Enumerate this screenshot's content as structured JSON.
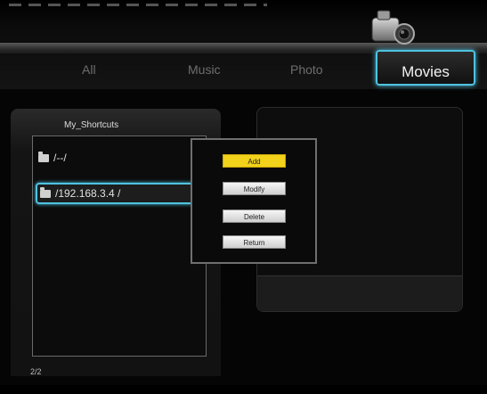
{
  "tabs": {
    "all": "All",
    "music": "Music",
    "photo": "Photo",
    "movies": "Movies"
  },
  "active_tab": "Movies",
  "left_panel": {
    "header": "My_Shortcuts",
    "items": [
      {
        "label": "/--/",
        "icon": "folder-icon"
      },
      {
        "label": "/192.168.3.4 /",
        "icon": "folder-icon",
        "selected": true
      }
    ],
    "page_count": "2/2"
  },
  "popup_menu": {
    "items": [
      "Add",
      "Modify",
      "Delete",
      "Return"
    ],
    "highlighted": "Add"
  },
  "colors": {
    "accent": "#4fc3e0",
    "highlight": "#f2d21a",
    "background": "#050505"
  },
  "icons": {
    "header": "camcorder-icon"
  }
}
